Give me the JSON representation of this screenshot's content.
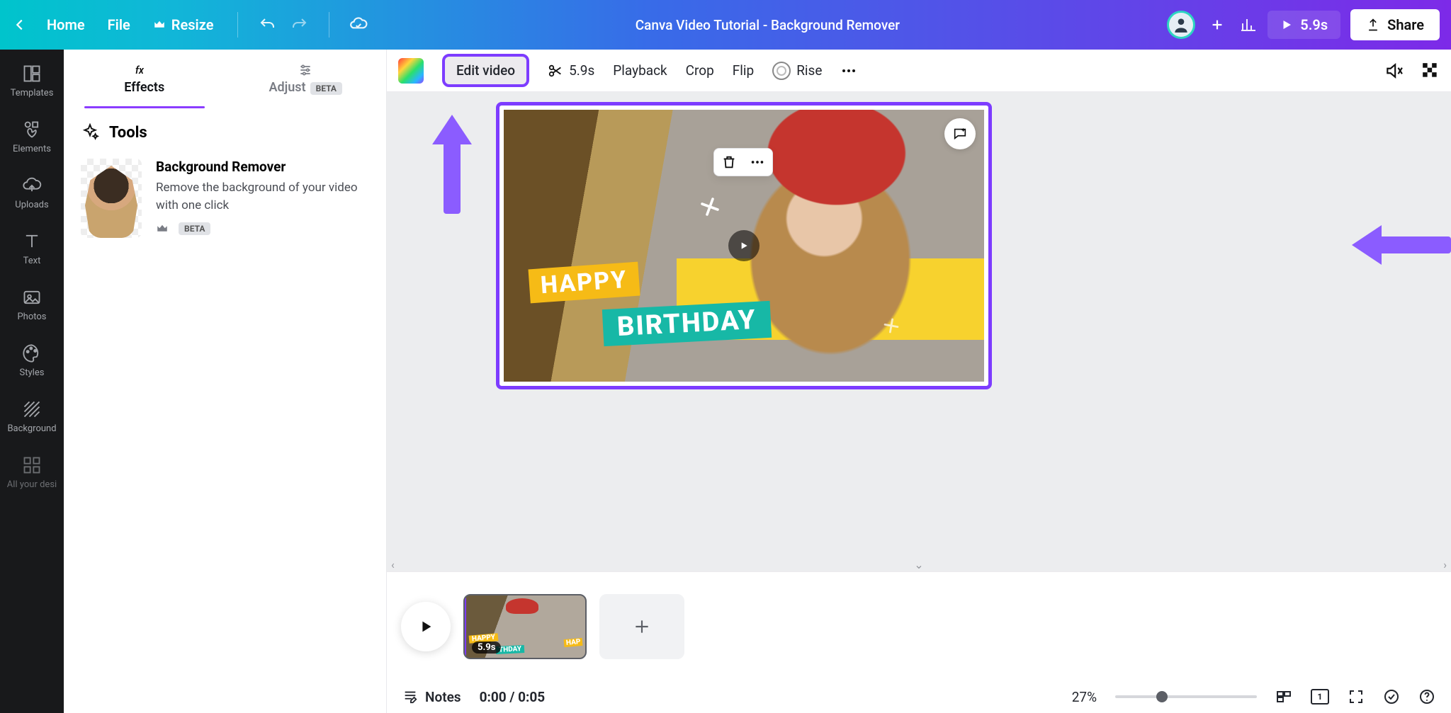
{
  "topbar": {
    "home": "Home",
    "file": "File",
    "resize": "Resize",
    "title": "Canva Video Tutorial - Background Remover",
    "duration": "5.9s",
    "share": "Share"
  },
  "rail": [
    {
      "id": "templates",
      "label": "Templates"
    },
    {
      "id": "elements",
      "label": "Elements"
    },
    {
      "id": "uploads",
      "label": "Uploads"
    },
    {
      "id": "text",
      "label": "Text"
    },
    {
      "id": "photos",
      "label": "Photos"
    },
    {
      "id": "styles",
      "label": "Styles"
    },
    {
      "id": "background",
      "label": "Background"
    },
    {
      "id": "more",
      "label": "All your desi"
    }
  ],
  "panel": {
    "tabs": {
      "effects": "Effects",
      "adjust": "Adjust",
      "beta": "BETA"
    },
    "tools_heading": "Tools",
    "tool": {
      "title": "Background Remover",
      "desc": "Remove the background of your video with one click",
      "beta": "BETA"
    }
  },
  "ctoolbar": {
    "edit_video": "Edit video",
    "trim_time": "5.9s",
    "playback": "Playback",
    "crop": "Crop",
    "flip": "Flip",
    "animate": "Rise"
  },
  "canvas": {
    "text1": "HAPPY",
    "text2": "BIRTHDAY"
  },
  "timeline": {
    "clip_duration": "5.9s",
    "clip_text1": "HAPPY",
    "clip_text2": "THDAY",
    "clip_text3": "HAP",
    "notes": "Notes",
    "time": "0:00 / 0:05",
    "zoom": "27%",
    "page": "1"
  }
}
